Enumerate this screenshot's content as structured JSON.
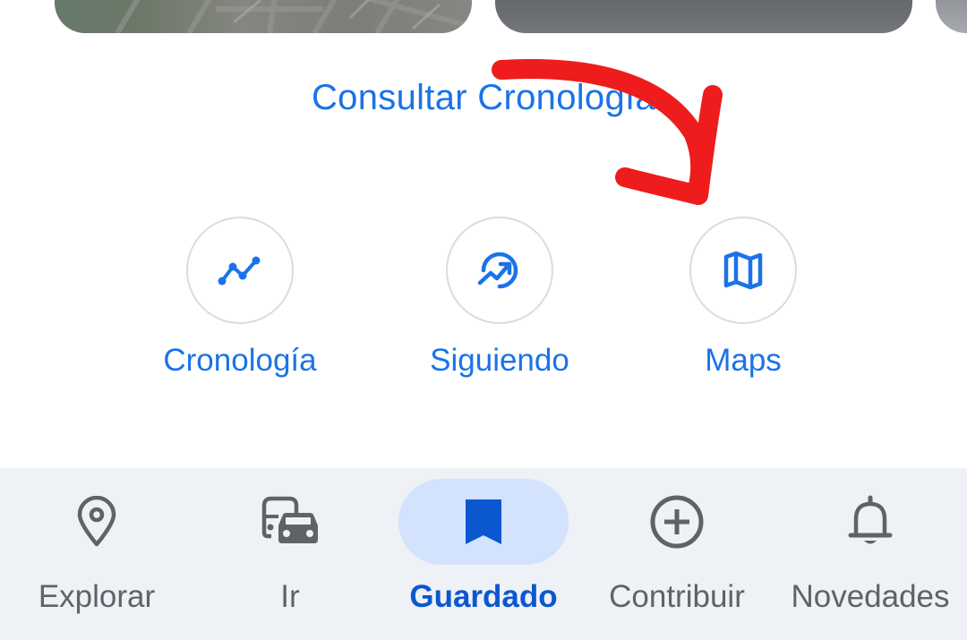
{
  "cards": {
    "icon_map": "map-thumbnail",
    "icon_photo": "photo-thumbnail"
  },
  "timeline_link": {
    "label": "Consultar Cronología"
  },
  "shortcuts": [
    {
      "label": "Cronología",
      "icon": "timeline-icon"
    },
    {
      "label": "Siguiendo",
      "icon": "following-trend-icon"
    },
    {
      "label": "Maps",
      "icon": "map-icon"
    }
  ],
  "annotation": {
    "icon": "red-arrow-icon",
    "color": "#ee1c1c"
  },
  "bottom_nav": {
    "items": [
      {
        "label": "Explorar",
        "icon": "location-pin-icon",
        "active": false
      },
      {
        "label": "Ir",
        "icon": "commute-icon",
        "active": false
      },
      {
        "label": "Guardado",
        "icon": "bookmark-icon",
        "active": true
      },
      {
        "label": "Contribuir",
        "icon": "add-circle-icon",
        "active": false
      },
      {
        "label": "Novedades",
        "icon": "bell-icon",
        "active": false
      }
    ]
  },
  "colors": {
    "accent": "#1a73e8",
    "active_nav": "#0b57d0",
    "active_pill": "#d3e3fd",
    "nav_background": "#eef1f6",
    "inactive": "#5f6368"
  }
}
